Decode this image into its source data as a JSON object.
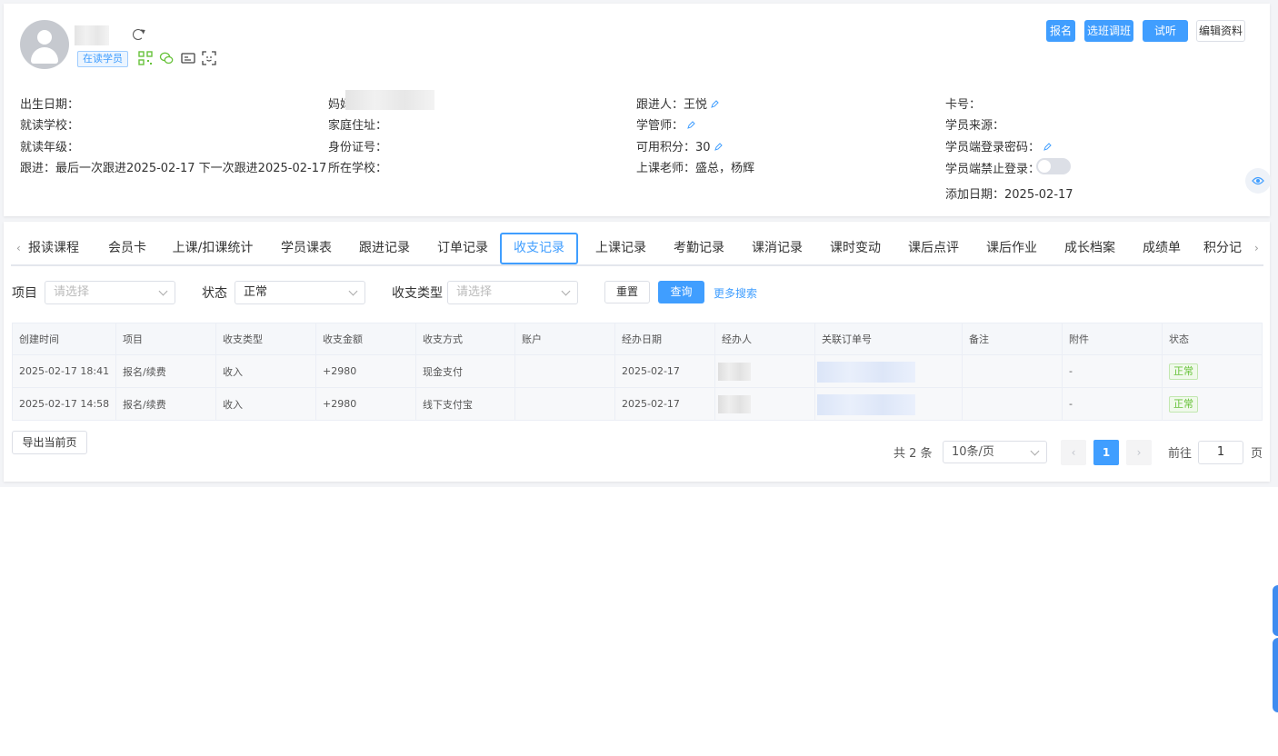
{
  "profile": {
    "status_tag": "在读学员",
    "actions": {
      "enroll": "报名",
      "select_class": "选班调班",
      "trial": "试听",
      "edit": "编辑资料"
    },
    "fields": {
      "col1": [
        "出生日期：",
        "就读学校：",
        "就读年级：",
        "跟进：最后一次跟进2025-02-17 下一次跟进2025-02-17"
      ],
      "col2": [
        "妈妈",
        "家庭住址：",
        "身份证号：",
        "所在学校："
      ],
      "col3": [
        "跟进人：王悦",
        "学管师：",
        "可用积分：30",
        "上课老师：盛总，杨辉"
      ],
      "col4": [
        "卡号：",
        "学员来源：",
        "学员端登录密码：",
        "学员端禁止登录：",
        "添加日期：2025-02-17"
      ]
    }
  },
  "tabs": [
    "报读课程",
    "会员卡",
    "上课/扣课统计",
    "学员课表",
    "跟进记录",
    "订单记录",
    "收支记录",
    "上课记录",
    "考勤记录",
    "课消记录",
    "课时变动",
    "课后点评",
    "课后作业",
    "成长档案",
    "成绩单",
    "积分记"
  ],
  "active_tab": "收支记录",
  "filters": {
    "item_label": "项目",
    "item_placeholder": "请选择",
    "status_label": "状态",
    "status_value": "正常",
    "type_label": "收支类型",
    "type_placeholder": "请选择",
    "reset": "重置",
    "query": "查询",
    "more": "更多搜索"
  },
  "table": {
    "columns": [
      "创建时间",
      "项目",
      "收支类型",
      "收支金额",
      "收支方式",
      "账户",
      "经办日期",
      "经办人",
      "关联订单号",
      "备注",
      "附件",
      "状态"
    ],
    "rows": [
      [
        "2025-02-17 18:41",
        "报名/续费",
        "收入",
        "+2980",
        "现金支付",
        "",
        "2025-02-17",
        "",
        "",
        "",
        "-",
        "正常"
      ],
      [
        "2025-02-17 14:58",
        "报名/续费",
        "收入",
        "+2980",
        "线下支付宝",
        "",
        "2025-02-17",
        "",
        "",
        "",
        "-",
        "正常"
      ]
    ]
  },
  "export_label": "导出当前页",
  "pagination": {
    "total": "共 2 条",
    "page_size": "10条/页",
    "current": "1",
    "goto_label": "前往",
    "goto_value": "1",
    "page_unit": "页",
    "prev": "‹",
    "next": "›"
  },
  "colors": {
    "primary": "#409eff",
    "success": "#67c23a"
  },
  "icons": [
    "refresh-icon",
    "qrcode-icon",
    "wechat-icon",
    "id-card-icon",
    "scan-icon",
    "pencil-icon",
    "eye-icon"
  ]
}
